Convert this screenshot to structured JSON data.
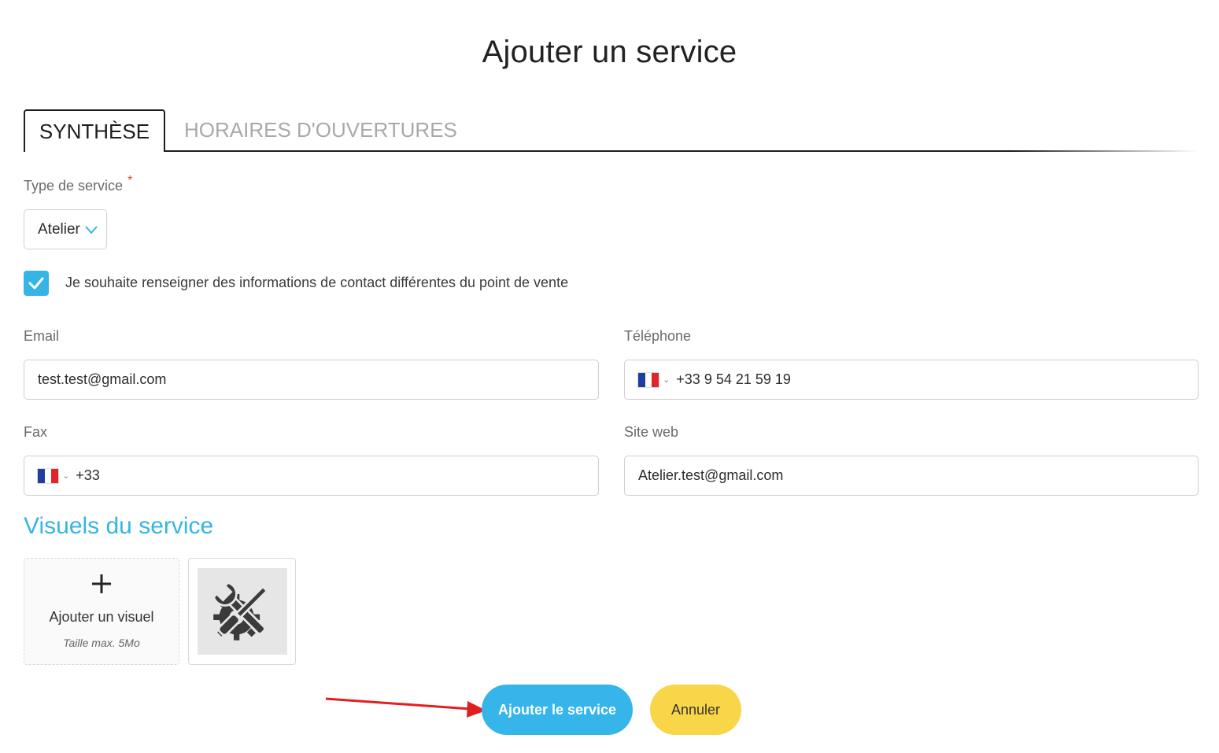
{
  "page": {
    "title": "Ajouter un service"
  },
  "tabs": [
    {
      "label": "SYNTHÈSE",
      "active": true
    },
    {
      "label": "HORAIRES D'OUVERTURES",
      "active": false
    }
  ],
  "service_type": {
    "label": "Type de service",
    "required_mark": "*",
    "value": "Atelier"
  },
  "contact_checkbox": {
    "checked": true,
    "label": "Je souhaite renseigner des informations de contact différentes du point de vente"
  },
  "fields": {
    "email": {
      "label": "Email",
      "value": "test.test@gmail.com"
    },
    "phone": {
      "label": "Téléphone",
      "country": "FR",
      "value": "+33 9 54 21 59 19"
    },
    "fax": {
      "label": "Fax",
      "country": "FR",
      "value": "+33"
    },
    "website": {
      "label": "Site web",
      "value": "Atelier.test@gmail.com"
    }
  },
  "visuals": {
    "title": "Visuels du service",
    "add_label": "Ajouter un visuel",
    "max_size": "Taille max. 5Mo",
    "images": [
      {
        "icon": "tools-icon"
      }
    ]
  },
  "actions": {
    "submit_label": "Ajouter le service",
    "cancel_label": "Annuler"
  },
  "colors": {
    "accent": "#35b5ea",
    "cancel": "#f9d648",
    "annotation_arrow": "#e02020"
  }
}
